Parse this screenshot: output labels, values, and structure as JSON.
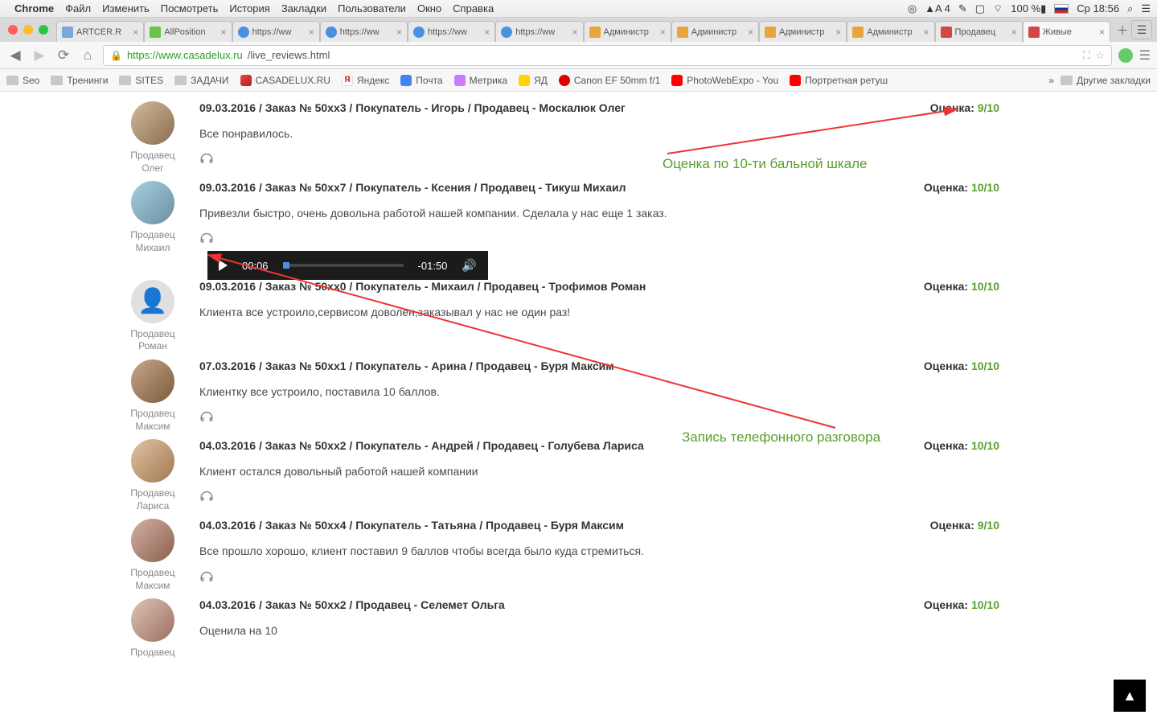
{
  "menubar": {
    "app": "Chrome",
    "items": [
      "Файл",
      "Изменить",
      "Посмотреть",
      "История",
      "Закладки",
      "Пользователи",
      "Окно",
      "Справка"
    ],
    "right": {
      "adobe": "A 4",
      "battery": "100 %",
      "clock": "Ср 18:56"
    }
  },
  "tabs": [
    {
      "title": "ARTCER.R",
      "fav": "generic"
    },
    {
      "title": "AllPosition",
      "fav": "green"
    },
    {
      "title": "https://ww",
      "fav": "blue"
    },
    {
      "title": "https://ww",
      "fav": "blue"
    },
    {
      "title": "https://ww",
      "fav": "blue"
    },
    {
      "title": "https://ww",
      "fav": "blue"
    },
    {
      "title": "Администр",
      "fav": "gold"
    },
    {
      "title": "Администр",
      "fav": "gold"
    },
    {
      "title": "Администр",
      "fav": "gold"
    },
    {
      "title": "Администр",
      "fav": "gold"
    },
    {
      "title": "Продавец",
      "fav": "red"
    },
    {
      "title": "Живые",
      "fav": "red",
      "active": true
    }
  ],
  "url": {
    "secure": "https://www.casadelux.ru",
    "path": "/live_reviews.html"
  },
  "bookmarks": [
    {
      "label": "Seo",
      "icon": "folder"
    },
    {
      "label": "Тренинги",
      "icon": "folder"
    },
    {
      "label": "SITES",
      "icon": "folder"
    },
    {
      "label": "ЗАДАЧИ",
      "icon": "folder"
    },
    {
      "label": "CASADELUX.RU",
      "icon": "csd"
    },
    {
      "label": "Яндекс",
      "icon": "ya"
    },
    {
      "label": "Почта",
      "icon": "mail"
    },
    {
      "label": "Метрика",
      "icon": "metrika"
    },
    {
      "label": "ЯД",
      "icon": "yad"
    },
    {
      "label": "Canon EF 50mm f/1",
      "icon": "canon"
    },
    {
      "label": "PhotoWebExpo - You",
      "icon": "yt"
    },
    {
      "label": "Портретная ретуш",
      "icon": "yt"
    }
  ],
  "bookmarks_overflow": "Другие закладки",
  "rating_label": "Оценка:",
  "seller_word": "Продавец",
  "reviews": [
    {
      "avatar": "p1",
      "seller": "Олег",
      "title": "09.03.2016 / Заказ № 50хх3 / Покупатель - Игорь / Продавец - Москалюк Олег",
      "text": "Все понравилось.",
      "rating": "9/10",
      "audio": false
    },
    {
      "avatar": "p2",
      "seller": "Михаил",
      "title": "09.03.2016 / Заказ № 50хх7 / Покупатель - Ксения / Продавец - Тикуш Михаил",
      "text": "Привезли быстро, очень довольна работой нашей компании. Сделала у нас еще 1 заказ.",
      "rating": "10/10",
      "audio": true
    },
    {
      "avatar": "p3",
      "seller": "Роман",
      "title": "09.03.2016 / Заказ № 50хх0 / Покупатель - Михаил / Продавец - Трофимов Роман",
      "text": "Клиента все устроило,сервисом доволен,заказывал у нас не один раз!",
      "rating": "10/10",
      "audio": false,
      "no_headphone": true
    },
    {
      "avatar": "p4",
      "seller": "Максим",
      "title": "07.03.2016 / Заказ № 50хх1 / Покупатель - Арина / Продавец - Буря Максим",
      "text": "Клиентку все устроило, поставила 10 баллов.",
      "rating": "10/10",
      "audio": false
    },
    {
      "avatar": "p5",
      "seller": "Лариса",
      "title": "04.03.2016 / Заказ № 50хх2 / Покупатель - Андрей / Продавец - Голубева Лариса",
      "text": "Клиент остался довольный работой нашей компании",
      "rating": "10/10",
      "audio": false
    },
    {
      "avatar": "p6",
      "seller": "Максим",
      "title": "04.03.2016 / Заказ № 50хх4 / Покупатель - Татьяна / Продавец - Буря Максим",
      "text": "Все прошло хорошо, клиент поставил 9 баллов чтобы всегда было куда стремиться.",
      "rating": "9/10",
      "audio": false
    },
    {
      "avatar": "p7",
      "seller": "",
      "title": "04.03.2016 / Заказ № 50хх2 / Продавец - Селемет Ольга",
      "text": "Оценила на 10",
      "rating": "10/10",
      "audio": false,
      "no_headphone": true
    }
  ],
  "audio": {
    "cur": "00:06",
    "rem": "-01:50"
  },
  "annotations": {
    "rating_note": "Оценка по 10-ти бальной шкале",
    "audio_note": "Запись телефонного разговора"
  }
}
